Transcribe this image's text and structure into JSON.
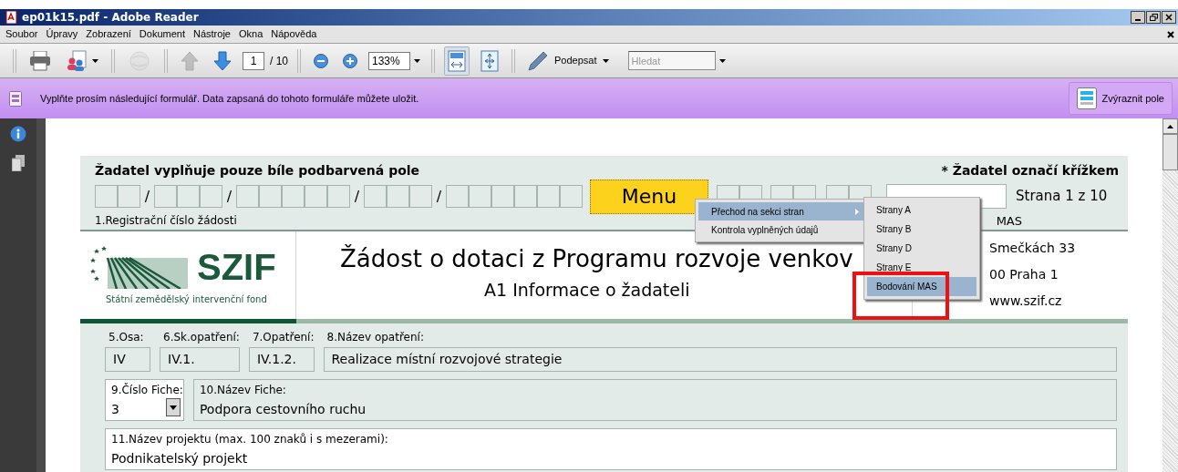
{
  "window": {
    "title": "ep01k15.pdf - Adobe Reader"
  },
  "menu_bar": {
    "items": [
      "Soubor",
      "Úpravy",
      "Zobrazení",
      "Dokument",
      "Nástroje",
      "Okna",
      "Nápověda"
    ]
  },
  "toolbar": {
    "groups": [
      [
        {
          "kind": "print",
          "disabled": false,
          "selected": false
        },
        {
          "kind": "share",
          "disabled": false,
          "selected": false
        }
      ],
      [
        {
          "kind": "web",
          "disabled": true,
          "selected": false
        }
      ],
      [
        {
          "kind": "previous",
          "disabled": true,
          "selected": false
        },
        {
          "kind": "next",
          "disabled": false,
          "selected": false
        },
        {
          "kind": "page",
          "disabled": false,
          "selected": false,
          "value": "1",
          "count": "/ 10"
        }
      ],
      [
        {
          "kind": "zoom-out",
          "disabled": false,
          "selected": false
        },
        {
          "kind": "zoom-in",
          "disabled": false,
          "selected": false
        },
        {
          "kind": "zoom",
          "disabled": false,
          "selected": false,
          "value": "133%"
        }
      ],
      [
        {
          "kind": "fit-width",
          "disabled": false,
          "selected": true
        },
        {
          "kind": "fit-page",
          "disabled": false,
          "selected": false
        }
      ],
      [
        {
          "kind": "sign",
          "disabled": false,
          "selected": false,
          "label": "Podepsat"
        },
        {
          "kind": "search",
          "disabled": false,
          "selected": false,
          "placeholder": "Hledat"
        }
      ]
    ]
  },
  "info_bar": {
    "message": "Vyplňte prosím následující formulář. Data zapsaná do tohoto formuláře můžete uložit.",
    "button": "Zvýraznit pole"
  },
  "form": {
    "instruction": "Žadatel vyplňuje pouze bíle podbarvená pole",
    "note": "* Žadatel označí křížkem",
    "registration_slashes": [
      "/",
      "/",
      "/",
      "/"
    ],
    "registration_label": "1.Registrační číslo žádosti",
    "menu_button": "Menu",
    "page_label": "Strana 1 z 10",
    "mas_label": "MAS",
    "logo": {
      "name": "SZIF",
      "subtitle": "Státní zemědělský intervenční fond"
    },
    "title": "Žádost o dotaci z Programu rozvoje venkov",
    "subtitle": "A1 Informace o žadateli",
    "address": [
      "Smečkách 33",
      "00 Praha 1",
      "www.szif.cz"
    ],
    "rows": [
      [
        {
          "label": "5.Osa:",
          "value": "IV",
          "kind": "text",
          "editable": false
        },
        {
          "label": "6.Sk.opatření:",
          "value": "IV.1.",
          "kind": "text",
          "editable": false
        },
        {
          "label": "7.Opatření:",
          "value": "IV.1.2.",
          "kind": "text",
          "editable": false
        },
        {
          "label": "8.Název opatření:",
          "value": "Realizace místní rozvojové strategie",
          "kind": "text",
          "editable": false
        }
      ],
      [
        {
          "label": "9.Číslo Fiche:",
          "value": "3",
          "kind": "select",
          "editable": true
        },
        {
          "label": "10.Název Fiche:",
          "value": "Podpora cestovního ruchu",
          "kind": "text",
          "editable": false
        }
      ],
      [
        {
          "label": "11.Název projektu (max. 100 znaků i s mezerami):",
          "value": "Podnikatelský projekt",
          "kind": "text",
          "editable": true
        }
      ]
    ]
  },
  "popup_menu": {
    "items": [
      {
        "label": "Přechod na sekci stran",
        "selected": true,
        "submenu": true
      },
      {
        "label": "Kontrola vyplněných údajů",
        "selected": false,
        "submenu": false
      }
    ]
  },
  "submenu": {
    "items": [
      {
        "label": "Strany A",
        "selected": false
      },
      {
        "label": "Strany B",
        "selected": false
      },
      {
        "label": "Strany D",
        "selected": false
      },
      {
        "label": "Strany E",
        "selected": false
      },
      {
        "label": "Bodování MAS",
        "selected": true
      }
    ]
  }
}
